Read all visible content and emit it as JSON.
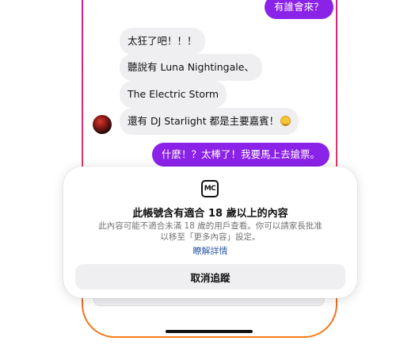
{
  "chat": {
    "out_top": "有誰會來？",
    "in_1": "太狂了吧！！！",
    "in_2": "聽說有 Luna Nightingale、",
    "in_3": "The Electric Storm",
    "in_4": "還有 DJ Starlight 都是主要嘉賓！",
    "out_bottom": "什麼！？太棒了！我要馬上去搶票。"
  },
  "sheet": {
    "icon_text": "MC",
    "title": "此帳號含有適合 18 歲以上的內容",
    "body_line1": "此內容可能不適合未滿 18 歲的用戶查看。你可以請家長批准",
    "body_line2": "以移至「更多內容」設定。",
    "learn_more": "瞭解詳情",
    "unfollow_button": "取消追蹤"
  },
  "colors": {
    "outgoing_bubble": "#8b22e8",
    "incoming_bubble": "#efeff2",
    "link": "#2e5aac"
  }
}
